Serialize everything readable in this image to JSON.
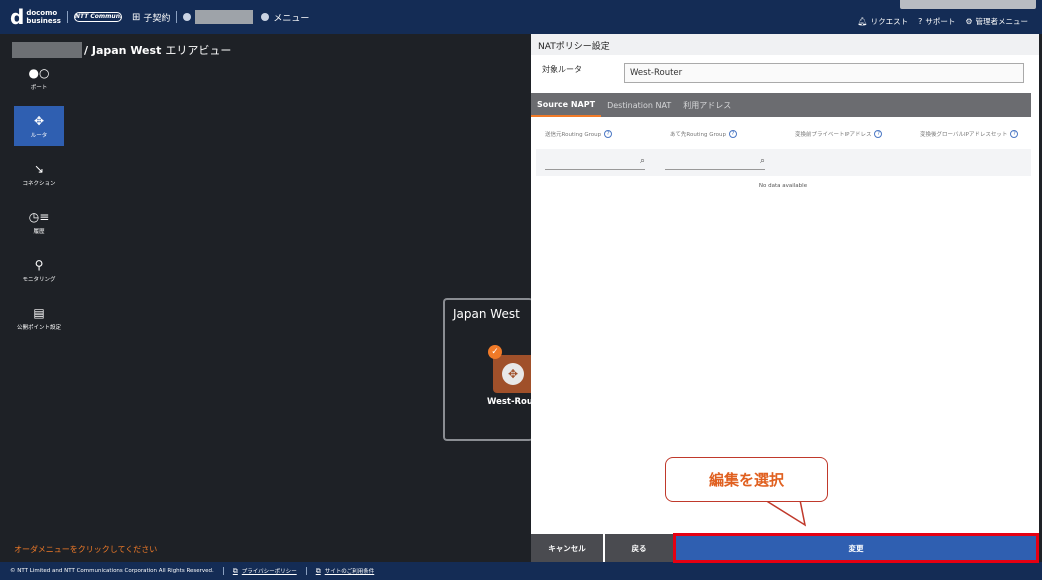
{
  "header": {
    "logo_mark": "d",
    "logo_text_1": "docomo",
    "logo_text_2": "business",
    "ntt_logo": "NTT Communications",
    "contract_label": "子契約",
    "menu_label": "メニュー",
    "request_label": "リクエスト",
    "support_label": "サポート",
    "admin_menu_label": "管理者メニュー"
  },
  "area": {
    "title_bold": "/ Japan West",
    "title_rest": "エリアビュー"
  },
  "sidebar": {
    "items": [
      {
        "icon": "port-icon",
        "glyph": "●○",
        "label": "ポート",
        "active": false
      },
      {
        "icon": "router-icon",
        "glyph": "✥",
        "label": "ルータ",
        "active": true
      },
      {
        "icon": "connection-icon",
        "glyph": "↘",
        "label": "コネクション",
        "active": false
      },
      {
        "icon": "history-icon",
        "glyph": "◷≡",
        "label": "履歴",
        "active": false
      },
      {
        "icon": "monitoring-icon",
        "glyph": "⚲",
        "label": "モニタリング",
        "active": false
      },
      {
        "icon": "public-point-icon",
        "glyph": "▤",
        "label": "公開ポイント設定",
        "active": false
      }
    ]
  },
  "map": {
    "region_title": "Japan West",
    "router_label": "West-Rout"
  },
  "order_hint": "オーダメニューをクリックしてください",
  "footer": {
    "copyright": "© NTT Limited and NTT Communications Corporation All Rights Reserved.",
    "privacy_link": "プライバシーポリシー",
    "terms_link": "サイトのご利用条件"
  },
  "panel": {
    "title": "NATポリシー設定",
    "target_label": "対象ルータ",
    "target_value": "West-Router",
    "tabs": [
      "Source NAPT",
      "Destination NAT",
      "利用アドレス"
    ],
    "columns": [
      "送信元Routing Group",
      "あて先Routing Group",
      "変換前プライベートIPアドレス",
      "変換後グローバルIPアドレスセット"
    ],
    "no_data": "No data available",
    "cancel_label": "キャンセル",
    "back_label": "戻る",
    "change_label": "変更"
  },
  "callout": {
    "text": "編集を選択"
  },
  "colors": {
    "header_bg": "#142c55",
    "accent_blue": "#2f5fb1",
    "accent_orange": "#f07a28",
    "highlight_red": "#e60012"
  }
}
